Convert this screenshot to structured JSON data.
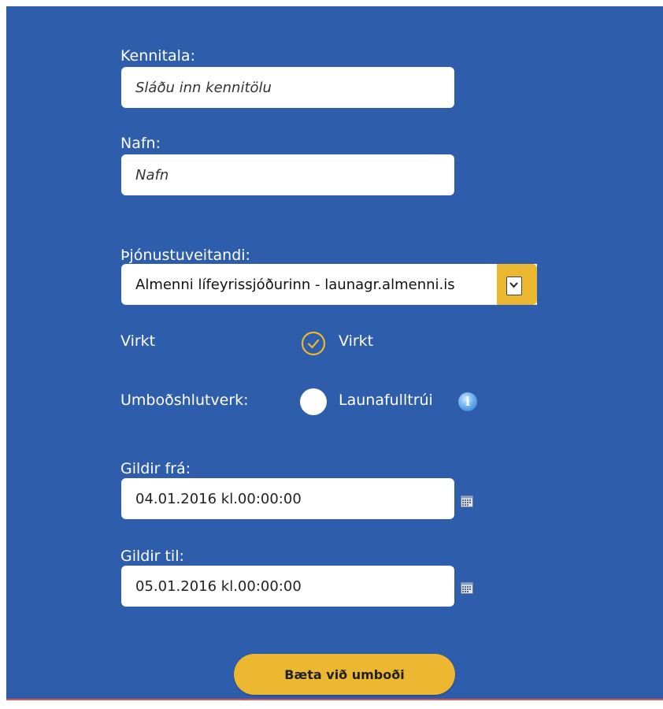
{
  "form": {
    "kennitala": {
      "label": "Kennitala:",
      "placeholder": "Sláðu inn kennitölu"
    },
    "nafn": {
      "label": "Nafn:",
      "placeholder": "Nafn"
    },
    "provider": {
      "label": "Þjónustuveitandi:",
      "selected": "Almenni lífeyrissjóðurinn - launagr.almenni.is"
    },
    "virkt": {
      "label": "Virkt",
      "option_label": "Virkt",
      "checked": true
    },
    "role": {
      "label": "Umboðshlutverk:",
      "option_label": "Launafulltrúi",
      "info_glyph": "i"
    },
    "valid_from": {
      "label": "Gildir frá:",
      "value": "04.01.2016 kl.00:00:00"
    },
    "valid_to": {
      "label": "Gildir til:",
      "value": "05.01.2016 kl.00:00:00"
    },
    "submit_label": "Bæta við umboði"
  },
  "colors": {
    "background": "#2d5dab",
    "accent": "#edb831",
    "text_light": "#ffffff"
  },
  "icons": [
    "check-circle-icon",
    "radio-icon",
    "info-icon",
    "calendar-icon",
    "chevron-down-icon"
  ]
}
